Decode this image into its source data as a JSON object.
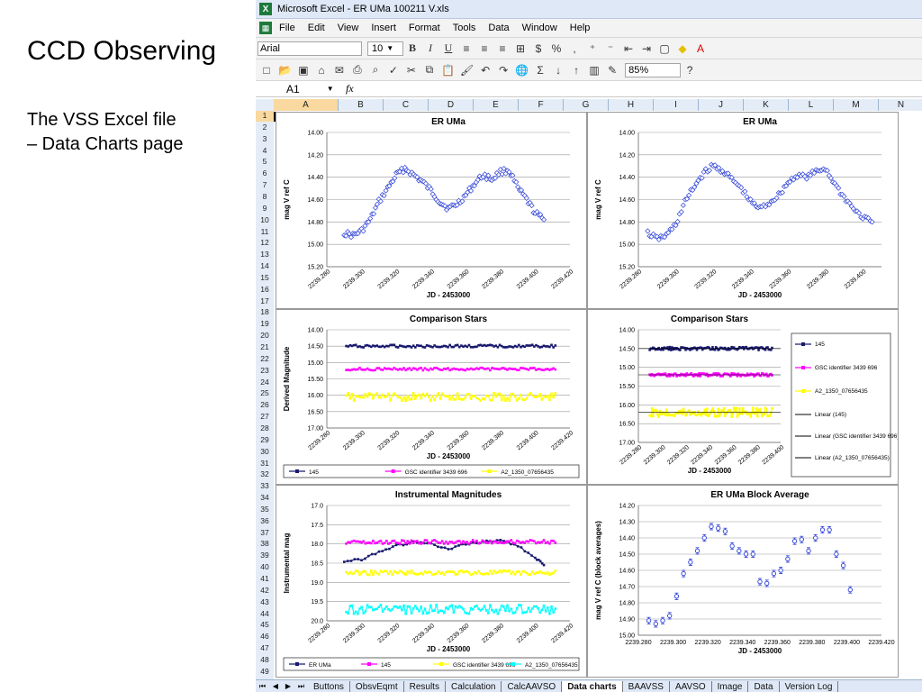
{
  "slide": {
    "title": "CCD Observing",
    "subtitle_line1": "The VSS Excel file",
    "subtitle_line2": "– Data Charts page"
  },
  "window": {
    "title": "Microsoft Excel - ER UMa 100211 V.xls"
  },
  "menu": [
    "File",
    "Edit",
    "View",
    "Insert",
    "Format",
    "Tools",
    "Data",
    "Window",
    "Help"
  ],
  "toolbar": {
    "font": "Arial",
    "size": "10",
    "zoom": "85%"
  },
  "formula_bar": {
    "cell_ref": "A1",
    "fx": "fx"
  },
  "columns": [
    "A",
    "B",
    "C",
    "D",
    "E",
    "F",
    "G",
    "H",
    "I",
    "J",
    "K",
    "L",
    "M",
    "N",
    "C"
  ],
  "rows": [
    "1",
    "2",
    "3",
    "4",
    "5",
    "6",
    "7",
    "8",
    "9",
    "10",
    "11",
    "12",
    "13",
    "14",
    "15",
    "16",
    "17",
    "18",
    "19",
    "20",
    "21",
    "22",
    "23",
    "24",
    "25",
    "26",
    "27",
    "28",
    "29",
    "30",
    "31",
    "32",
    "33",
    "34",
    "35",
    "36",
    "37",
    "38",
    "39",
    "40",
    "41",
    "42",
    "43",
    "44",
    "45",
    "46",
    "47",
    "48",
    "49"
  ],
  "tabs": [
    "Buttons",
    "ObsvEqmt",
    "Results",
    "Calculation",
    "CalcAAVSO",
    "Data charts",
    "BAAVSS",
    "AAVSO",
    "Image",
    "Data",
    "Version Log"
  ],
  "active_tab": "Data charts",
  "colors": {
    "navy": "#1a1a6e",
    "magenta": "#ff00ff",
    "yellow": "#ffff00",
    "cyan": "#00ffff",
    "blue": "#2b3fd6"
  },
  "chart_data": [
    {
      "id": "er-uma-1",
      "type": "scatter",
      "title": "ER UMa",
      "xlabel": "JD - 2453000",
      "ylabel": "mag V ref C",
      "ylim": [
        15.2,
        14.0
      ],
      "y_ticks": [
        "14.00",
        "14.20",
        "14.40",
        "14.60",
        "14.80",
        "15.00",
        "15.20"
      ],
      "xlim": [
        2239.28,
        2239.42
      ],
      "x_ticks": [
        "2239.280",
        "2239.300",
        "2239.320",
        "2239.340",
        "2239.360",
        "2239.380",
        "2239.400",
        "2239.420"
      ],
      "series": [
        {
          "color": "#2b3fd6",
          "x": [
            2239.29,
            2239.295,
            2239.3,
            2239.305,
            2239.31,
            2239.315,
            2239.32,
            2239.325,
            2239.33,
            2239.335,
            2239.34,
            2239.345,
            2239.35,
            2239.355,
            2239.36,
            2239.365,
            2239.37,
            2239.375,
            2239.38,
            2239.385,
            2239.39,
            2239.395,
            2239.4,
            2239.405
          ],
          "y": [
            14.9,
            14.92,
            14.88,
            14.78,
            14.62,
            14.5,
            14.38,
            14.32,
            14.38,
            14.44,
            14.52,
            14.62,
            14.68,
            14.64,
            14.56,
            14.46,
            14.38,
            14.42,
            14.35,
            14.34,
            14.5,
            14.6,
            14.72,
            14.78
          ]
        }
      ]
    },
    {
      "id": "er-uma-2",
      "type": "scatter",
      "title": "ER UMa",
      "xlabel": "JD - 2453000",
      "ylabel": "mag V ref C",
      "ylim": [
        15.2,
        14.0
      ],
      "y_ticks": [
        "14.00",
        "14.20",
        "14.40",
        "14.60",
        "14.80",
        "15.00",
        "15.20"
      ],
      "xlim": [
        2239.28,
        2239.41
      ],
      "x_ticks": [
        "2239.280",
        "2239.300",
        "2239.320",
        "2239.340",
        "2239.360",
        "2239.380",
        "2239.400"
      ],
      "series": [
        {
          "color": "#2b3fd6",
          "x": [
            2239.285,
            2239.29,
            2239.295,
            2239.3,
            2239.305,
            2239.31,
            2239.315,
            2239.32,
            2239.325,
            2239.33,
            2239.335,
            2239.34,
            2239.345,
            2239.35,
            2239.355,
            2239.36,
            2239.365,
            2239.37,
            2239.375,
            2239.38,
            2239.385,
            2239.39,
            2239.395,
            2239.4,
            2239.405
          ],
          "y": [
            14.9,
            14.95,
            14.92,
            14.82,
            14.62,
            14.48,
            14.36,
            14.3,
            14.34,
            14.42,
            14.5,
            14.62,
            14.68,
            14.63,
            14.56,
            14.45,
            14.38,
            14.4,
            14.35,
            14.32,
            14.46,
            14.58,
            14.68,
            14.76,
            14.8
          ]
        }
      ]
    },
    {
      "id": "comparison-1",
      "type": "scatter",
      "title": "Comparison Stars",
      "xlabel": "JD - 2453000",
      "ylabel": "Derived Magnitude",
      "ylim": [
        17.0,
        14.0
      ],
      "y_ticks": [
        "14.00",
        "14.50",
        "15.00",
        "15.50",
        "16.00",
        "16.50",
        "17.00"
      ],
      "xlim": [
        2239.28,
        2239.42
      ],
      "x_ticks": [
        "2239.280",
        "2239.300",
        "2239.320",
        "2239.340",
        "2239.360",
        "2239.380",
        "2239.400",
        "2239.420"
      ],
      "legend": "bottom",
      "series": [
        {
          "name": "145",
          "color": "#1a1a6e",
          "level": 14.5,
          "noise": 0.04
        },
        {
          "name": "GSC identifier 3439 696",
          "color": "#ff00ff",
          "level": 15.2,
          "noise": 0.04
        },
        {
          "name": "A2_1350_07656435",
          "color": "#ffff00",
          "level": 16.05,
          "noise": 0.12
        }
      ]
    },
    {
      "id": "comparison-2",
      "type": "scatter",
      "title": "Comparison Stars",
      "xlabel": "JD - 2453000",
      "ylabel": "",
      "ylim": [
        17.0,
        14.0
      ],
      "y_ticks": [
        "14.00",
        "14.50",
        "15.00",
        "15.50",
        "16.00",
        "16.50",
        "17.00"
      ],
      "xlim": [
        2239.28,
        2239.4
      ],
      "x_ticks": [
        "2239.280",
        "2239.300",
        "2239.320",
        "2239.340",
        "2239.360",
        "2239.380",
        "2239.400"
      ],
      "legend": "right",
      "series": [
        {
          "name": "145",
          "color": "#1a1a6e",
          "level": 14.5,
          "noise": 0.04
        },
        {
          "name": "GSC identifier 3439 696",
          "color": "#ff00ff",
          "level": 15.2,
          "noise": 0.04
        },
        {
          "name": "A2_1350_07656435",
          "color": "#ffff00",
          "level": 16.2,
          "noise": 0.12
        }
      ],
      "trendlines": [
        {
          "name": "Linear (145)"
        },
        {
          "name": "Linear (GSC identifier 3439 696)"
        },
        {
          "name": "Linear (A2_1350_07656435)"
        }
      ]
    },
    {
      "id": "instrumental",
      "type": "scatter",
      "title": "Instrumental Magnitudes",
      "xlabel": "JD - 2453000",
      "ylabel": "Instrumental mag",
      "ylim": [
        20.0,
        17.0
      ],
      "y_ticks": [
        "17.0",
        "17.5",
        "18.0",
        "18.5",
        "19.0",
        "19.5",
        "20.0"
      ],
      "xlim": [
        2239.28,
        2239.42
      ],
      "x_ticks": [
        "2239.280",
        "2239.300",
        "2239.320",
        "2239.340",
        "2239.360",
        "2239.380",
        "2239.400",
        "2239.420"
      ],
      "legend": "bottom",
      "series": [
        {
          "name": "ER UMa",
          "color": "#1a1a6e",
          "x": [
            2239.29,
            2239.3,
            2239.31,
            2239.32,
            2239.33,
            2239.34,
            2239.35,
            2239.36,
            2239.37,
            2239.38,
            2239.39,
            2239.4,
            2239.405
          ],
          "y": [
            18.45,
            18.4,
            18.2,
            18.05,
            17.95,
            18.0,
            18.15,
            18.0,
            17.95,
            17.9,
            18.05,
            18.35,
            18.55
          ]
        },
        {
          "name": "145",
          "color": "#ff00ff",
          "level": 17.95,
          "noise": 0.05
        },
        {
          "name": "GSC identifier 3439 696",
          "color": "#ffff00",
          "level": 18.75,
          "noise": 0.06
        },
        {
          "name": "A2_1350_07656435",
          "color": "#00ffff",
          "level": 19.7,
          "noise": 0.12
        }
      ]
    },
    {
      "id": "block-average",
      "type": "scatter",
      "title": "ER UMa Block Average",
      "xlabel": "JD - 2453000",
      "ylabel": "mag V ref C (block averages)",
      "ylim": [
        15.0,
        14.2
      ],
      "y_ticks": [
        "14.20",
        "14.30",
        "14.40",
        "14.50",
        "14.60",
        "14.70",
        "14.80",
        "14.90",
        "15.00"
      ],
      "xlim": [
        2239.28,
        2239.42
      ],
      "x_ticks": [
        "2239.280",
        "2239.300",
        "2239.320",
        "2239.340",
        "2239.360",
        "2239.380",
        "2239.400",
        "2239.420"
      ],
      "series": [
        {
          "color": "#2b3fd6",
          "x": [
            2239.286,
            2239.29,
            2239.294,
            2239.298,
            2239.302,
            2239.306,
            2239.31,
            2239.314,
            2239.318,
            2239.322,
            2239.326,
            2239.33,
            2239.334,
            2239.338,
            2239.342,
            2239.346,
            2239.35,
            2239.354,
            2239.358,
            2239.362,
            2239.366,
            2239.37,
            2239.374,
            2239.378,
            2239.382,
            2239.386,
            2239.39,
            2239.394,
            2239.398,
            2239.402
          ],
          "y": [
            14.91,
            14.93,
            14.91,
            14.88,
            14.76,
            14.62,
            14.55,
            14.48,
            14.4,
            14.33,
            14.34,
            14.36,
            14.45,
            14.48,
            14.5,
            14.5,
            14.67,
            14.68,
            14.62,
            14.6,
            14.53,
            14.42,
            14.41,
            14.48,
            14.4,
            14.35,
            14.35,
            14.5,
            14.57,
            14.72
          ],
          "err": 0.02
        }
      ]
    }
  ]
}
